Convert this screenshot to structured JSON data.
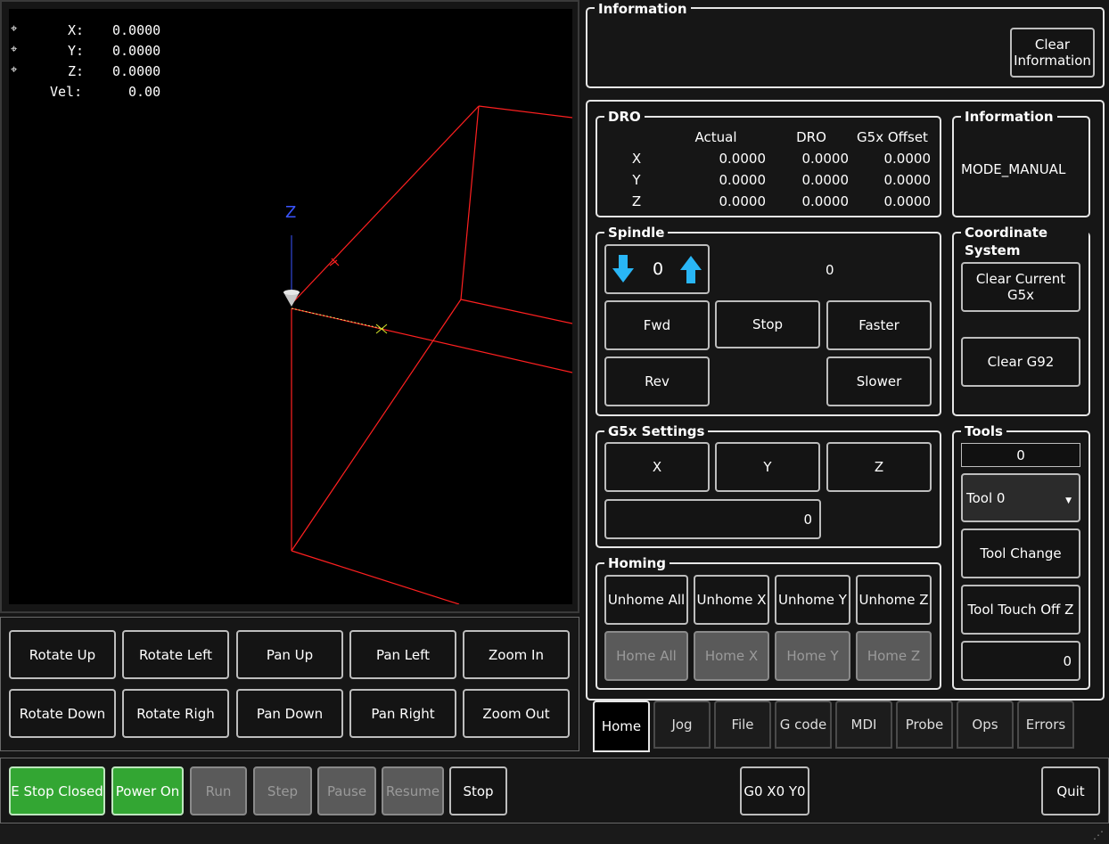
{
  "viewport": {
    "readout": {
      "x_label": "X:",
      "x_value": "0.0000",
      "y_label": "Y:",
      "y_value": "0.0000",
      "z_label": "Z:",
      "z_value": "0.0000",
      "vel_label": "Vel:",
      "vel_value": "0.00"
    },
    "axis_label_z": "Z"
  },
  "view_controls": {
    "rotate_up": "Rotate Up",
    "rotate_left": "Rotate Left",
    "pan_up": "Pan Up",
    "pan_left": "Pan Left",
    "zoom_in": "Zoom In",
    "rotate_down": "Rotate Down",
    "rotate_right": "Rotate Righ",
    "pan_down": "Pan Down",
    "pan_right": "Pan Right",
    "zoom_out": "Zoom Out"
  },
  "information_top": {
    "title": "Information",
    "clear_button": "Clear\nInformation"
  },
  "dro": {
    "title": "DRO",
    "headers": [
      "Actual",
      "DRO",
      "G5x Offset"
    ],
    "rows": [
      {
        "axis": "X",
        "actual": "0.0000",
        "dro": "0.0000",
        "offset": "0.0000"
      },
      {
        "axis": "Y",
        "actual": "0.0000",
        "dro": "0.0000",
        "offset": "0.0000"
      },
      {
        "axis": "Z",
        "actual": "0.0000",
        "dro": "0.0000",
        "offset": "0.0000"
      }
    ]
  },
  "information_side": {
    "title": "Information",
    "mode": "MODE_MANUAL"
  },
  "spindle": {
    "title": "Spindle",
    "speed_value": "0",
    "speed_display": "0",
    "fwd": "Fwd",
    "stop": "Stop",
    "faster": "Faster",
    "rev": "Rev",
    "slower": "Slower"
  },
  "coordinate_system": {
    "title": "Coordinate System",
    "clear_current": "Clear Current G5x",
    "clear_g92": "Clear G92"
  },
  "g5x_settings": {
    "title": "G5x Settings",
    "x": "X",
    "y": "Y",
    "z": "Z",
    "value": "0"
  },
  "tools": {
    "title": "Tools",
    "tool_number": "0",
    "selected_tool": "Tool 0",
    "tool_change": "Tool Change",
    "touch_off": "Tool Touch Off Z",
    "touch_value": "0"
  },
  "homing": {
    "title": "Homing",
    "unhome_all": "Unhome All",
    "unhome_x": "Unhome X",
    "unhome_y": "Unhome Y",
    "unhome_z": "Unhome Z",
    "home_all": "Home All",
    "home_x": "Home X",
    "home_y": "Home Y",
    "home_z": "Home Z"
  },
  "tabs": [
    "Home",
    "Jog",
    "File",
    "G code",
    "MDI",
    "Probe",
    "Ops",
    "Errors"
  ],
  "bottom_bar": {
    "estop": "E Stop Closed",
    "power": "Power On",
    "run": "Run",
    "step": "Step",
    "pause": "Pause",
    "resume": "Resume",
    "stop": "Stop",
    "g0": "G0 X0 Y0",
    "quit": "Quit"
  },
  "colors": {
    "toolpath": "#ff2020",
    "accent_green": "#33a633",
    "arrow_blue": "#29b6f6"
  }
}
